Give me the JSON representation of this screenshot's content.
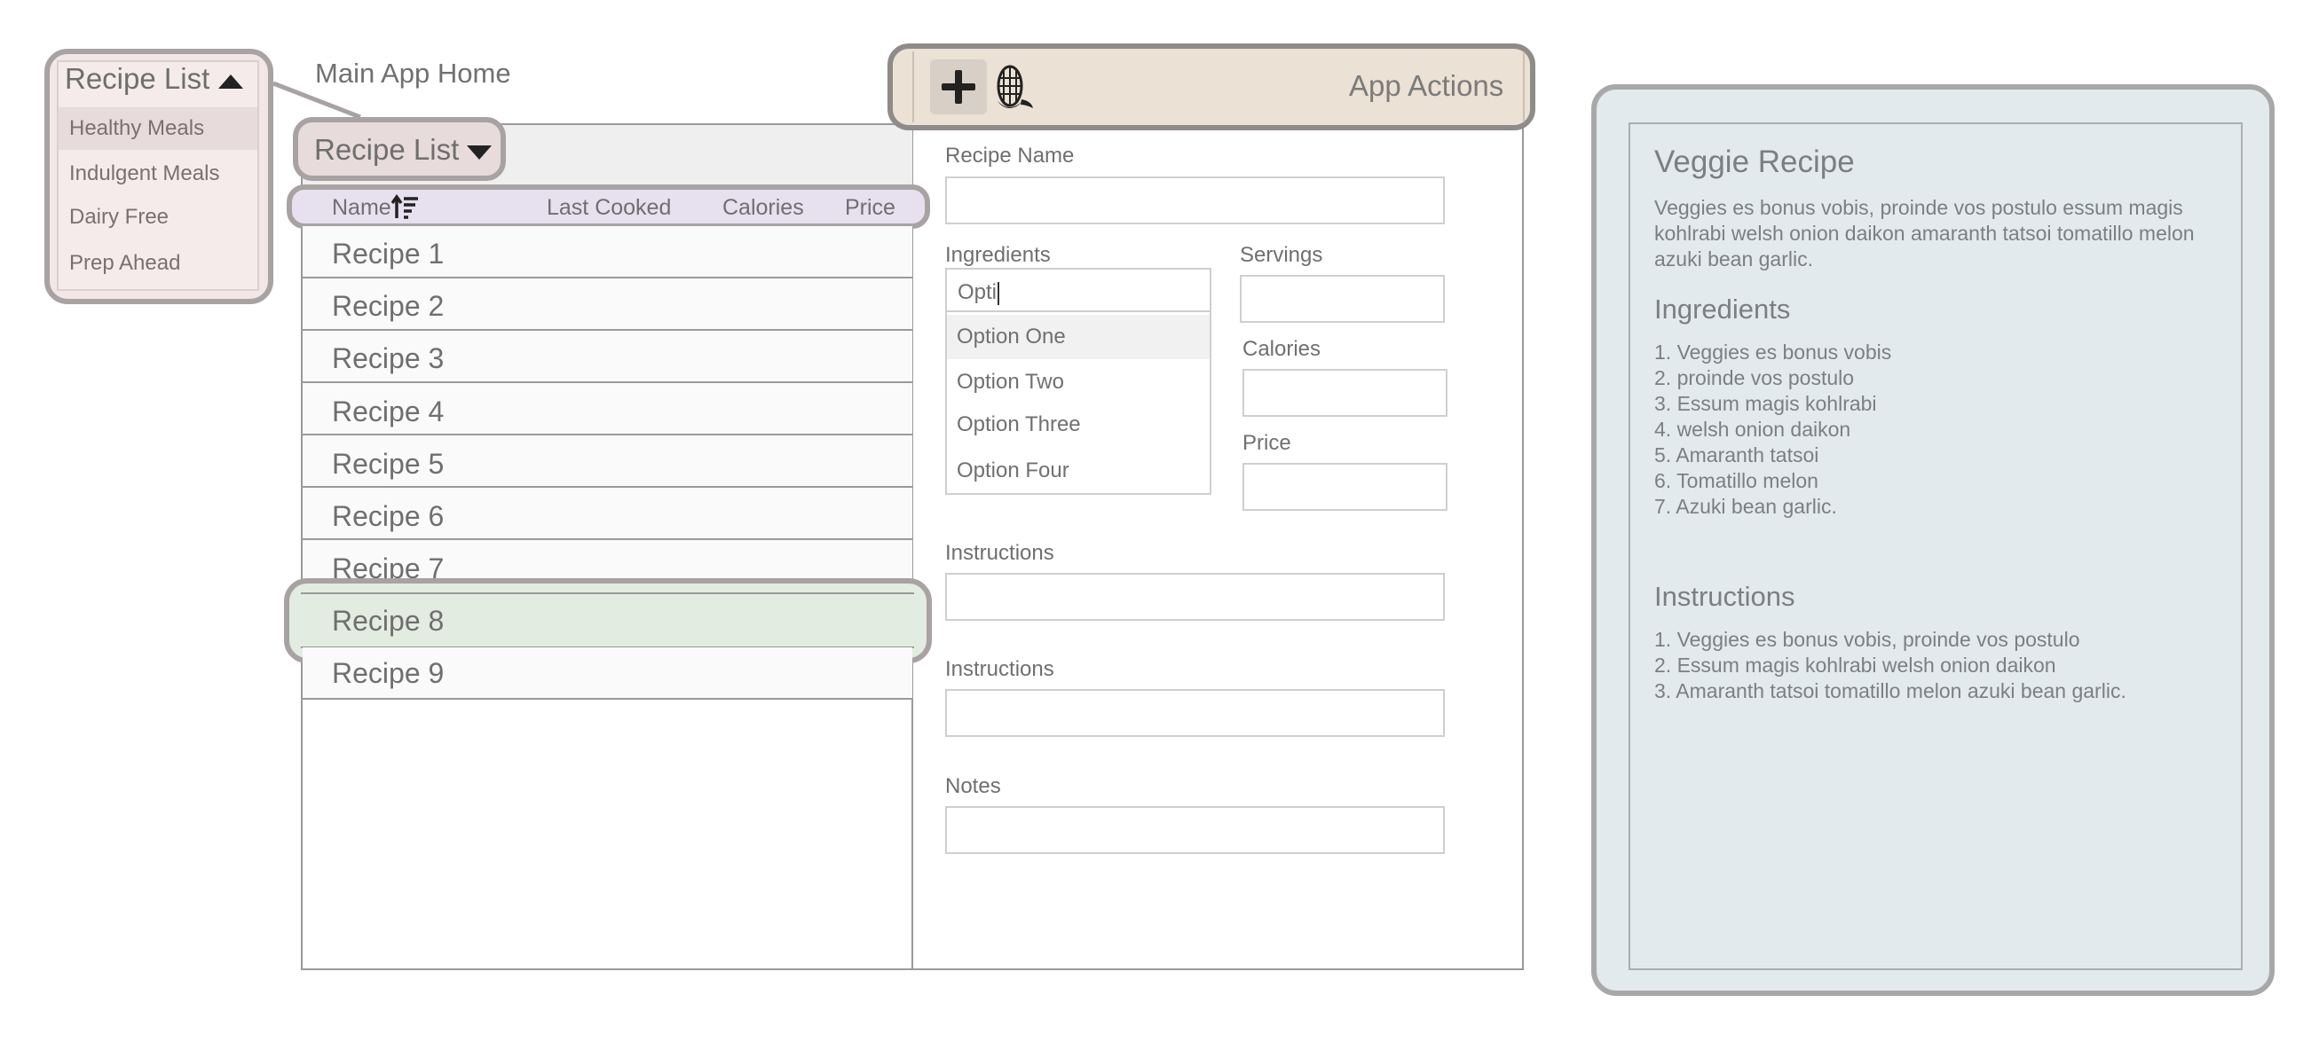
{
  "popup_menu": {
    "title": "Recipe List",
    "items": [
      {
        "label": "Healthy Meals",
        "selected": true
      },
      {
        "label": "Indulgent Meals",
        "selected": false
      },
      {
        "label": "Dairy Free",
        "selected": false
      },
      {
        "label": "Prep Ahead",
        "selected": false
      }
    ],
    "icon": "caret-up-icon"
  },
  "main": {
    "title": "Main App Home"
  },
  "recipe_list": {
    "dropdown_label": "Recipe List",
    "dropdown_icon": "caret-down-icon",
    "columns": [
      "Name",
      "Last Cooked",
      "Calories",
      "Price"
    ],
    "sort_icon": "sort-ascending-icon",
    "rows": [
      "Recipe 1",
      "Recipe 2",
      "Recipe 3",
      "Recipe 4",
      "Recipe 5",
      "Recipe 6",
      "Recipe 7",
      "Recipe 8",
      "Recipe 9"
    ],
    "selected_row": "Recipe 8"
  },
  "toolbar": {
    "label": "App Actions",
    "buttons": [
      {
        "icon": "plus-icon"
      },
      {
        "icon": "corn-icon"
      }
    ]
  },
  "form": {
    "recipe_name_label": "Recipe Name",
    "ingredients_label": "Ingredients",
    "ingredients_value": "Opti",
    "options": [
      "Option One",
      "Option Two",
      "Option Three",
      "Option Four"
    ],
    "servings_label": "Servings",
    "calories_label": "Calories",
    "price_label": "Price",
    "instructions_label_1": "Instructions",
    "instructions_label_2": "Instructions",
    "notes_label": "Notes"
  },
  "card": {
    "title": "Veggie Recipe",
    "description": "Veggies es bonus vobis, proinde vos postulo essum magis kohlrabi welsh onion daikon amaranth tatsoi tomatillo melon azuki bean garlic.",
    "ingredients_heading": "Ingredients",
    "ingredients": [
      "1. Veggies es bonus vobis",
      "2. proinde vos postulo",
      "3. Essum magis kohlrabi",
      "4. welsh onion daikon",
      "5. Amaranth tatsoi",
      "6. Tomatillo melon",
      "7. Azuki bean garlic."
    ],
    "instructions_heading": "Instructions",
    "instructions": [
      "1. Veggies es bonus vobis, proinde vos postulo",
      "2. Essum magis kohlrabi welsh onion daikon",
      "3. Amaranth tatsoi tomatillo melon azuki bean garlic."
    ]
  },
  "colors": {
    "popup_bg": "#f2e6e6",
    "header_highlight": "#e6e0ef",
    "selected_row": "#e2ece0",
    "toolbar_bg": "#ebe1d4",
    "card_bg": "#e3eaed",
    "callout_border": "#a8a2a2"
  }
}
